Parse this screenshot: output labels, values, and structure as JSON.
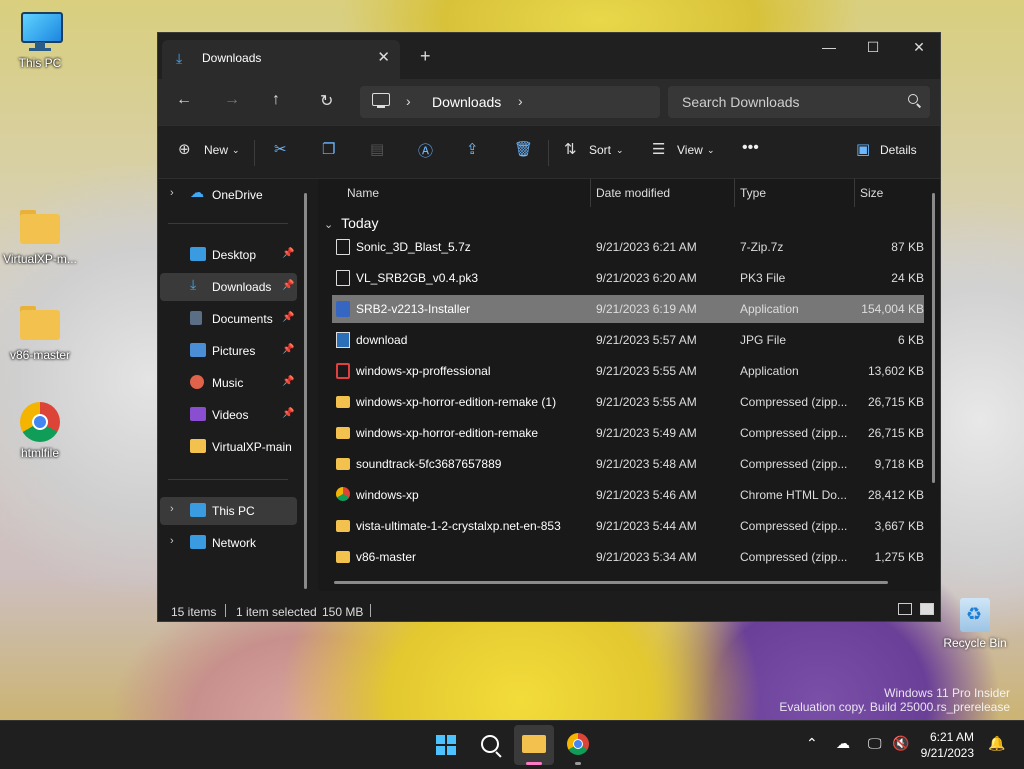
{
  "desktop": {
    "icons": [
      {
        "label": "This PC"
      },
      {
        "label": "VirtualXP-m..."
      },
      {
        "label": "v86-master"
      },
      {
        "label": "htmlfile"
      }
    ],
    "recycle_bin": "Recycle Bin",
    "watermark_line1": "Windows 11 Pro Insider",
    "watermark_line2": "Evaluation copy. Build 25000.rs_prerelease"
  },
  "window": {
    "tab_title": "Downloads",
    "address_location": "Downloads",
    "search_placeholder": "Search Downloads",
    "commands": {
      "new": "New",
      "sort": "Sort",
      "view": "View",
      "details": "Details"
    },
    "nav_pane": {
      "onedrive": "OneDrive",
      "quick": [
        {
          "label": "Desktop"
        },
        {
          "label": "Downloads"
        },
        {
          "label": "Documents"
        },
        {
          "label": "Pictures"
        },
        {
          "label": "Music"
        },
        {
          "label": "Videos"
        },
        {
          "label": "VirtualXP-main"
        }
      ],
      "this_pc": "This PC",
      "network": "Network"
    },
    "columns": {
      "name": "Name",
      "date": "Date modified",
      "type": "Type",
      "size": "Size"
    },
    "group": "Today",
    "files": [
      {
        "name": "Sonic_3D_Blast_5.7z",
        "date": "9/21/2023 6:21 AM",
        "type": "7-Zip.7z",
        "size": "87 KB"
      },
      {
        "name": "VL_SRB2GB_v0.4.pk3",
        "date": "9/21/2023 6:20 AM",
        "type": "PK3 File",
        "size": "24 KB"
      },
      {
        "name": "SRB2-v2213-Installer",
        "date": "9/21/2023 6:19 AM",
        "type": "Application",
        "size": "154,004 KB"
      },
      {
        "name": "download",
        "date": "9/21/2023 5:57 AM",
        "type": "JPG File",
        "size": "6 KB"
      },
      {
        "name": "windows-xp-proffessional",
        "date": "9/21/2023 5:55 AM",
        "type": "Application",
        "size": "13,602 KB"
      },
      {
        "name": "windows-xp-horror-edition-remake (1)",
        "date": "9/21/2023 5:55 AM",
        "type": "Compressed (zipp...",
        "size": "26,715 KB"
      },
      {
        "name": "windows-xp-horror-edition-remake",
        "date": "9/21/2023 5:49 AM",
        "type": "Compressed (zipp...",
        "size": "26,715 KB"
      },
      {
        "name": "soundtrack-5fc3687657889",
        "date": "9/21/2023 5:48 AM",
        "type": "Compressed (zipp...",
        "size": "9,718 KB"
      },
      {
        "name": "windows-xp",
        "date": "9/21/2023 5:46 AM",
        "type": "Chrome HTML Do...",
        "size": "28,412 KB"
      },
      {
        "name": "vista-ultimate-1-2-crystalxp.net-en-853",
        "date": "9/21/2023 5:44 AM",
        "type": "Compressed (zipp...",
        "size": "3,667 KB"
      },
      {
        "name": "v86-master",
        "date": "9/21/2023 5:34 AM",
        "type": "Compressed (zipp...",
        "size": "1,275 KB"
      }
    ],
    "status": {
      "count": "15 items",
      "selected": "1 item selected",
      "size": "150 MB"
    }
  },
  "taskbar": {
    "time": "6:21 AM",
    "date": "9/21/2023"
  },
  "colors": {
    "accent": "#4cc2ff",
    "selection": "#777777",
    "window_bg": "#1c1c1c"
  }
}
